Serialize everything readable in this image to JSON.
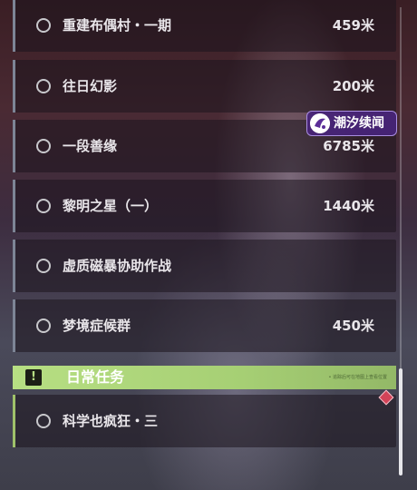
{
  "quests": [
    {
      "name": "重建布偶村・一期",
      "distance": "459米"
    },
    {
      "name": "往日幻影",
      "distance": "200米"
    },
    {
      "name": "一段善缘",
      "distance": "6785米"
    },
    {
      "name": "黎明之星（一）",
      "distance": "1440米"
    },
    {
      "name": "虚质磁暴协助作战",
      "distance": ""
    },
    {
      "name": "梦境症候群",
      "distance": "450米"
    }
  ],
  "daily_section": {
    "icon_glyph": "!",
    "title": "日常任务",
    "tip_text": "• 追踪后可在地图上查看位置",
    "accent_color": "#b7df83"
  },
  "daily_quests": [
    {
      "name": "科学也疯狂・三"
    }
  ],
  "logo": {
    "text": "潮汐续闻"
  },
  "colors": {
    "quest_accent": "#7d8596",
    "daily_accent": "#9fc26a",
    "tracked_marker": "#d34358",
    "logo_bg": "#48247a"
  }
}
